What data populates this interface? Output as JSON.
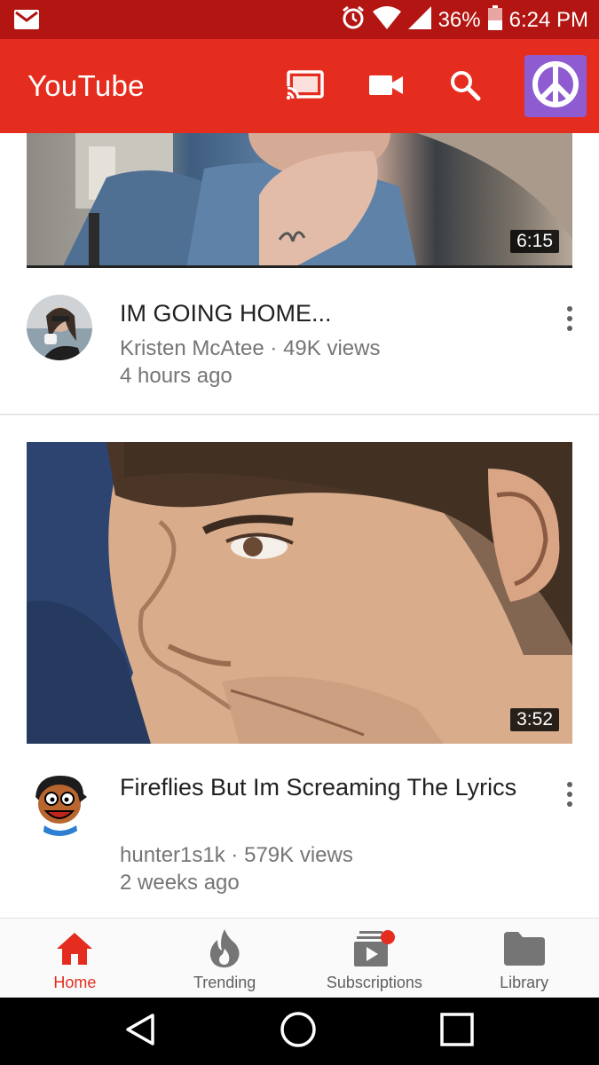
{
  "status_bar": {
    "battery": "36%",
    "time": "6:24 PM",
    "icons": [
      "gmail-icon",
      "alarm-icon",
      "wifi-icon",
      "signal-icon",
      "battery-icon"
    ]
  },
  "app_bar": {
    "title": "YouTube",
    "actions": [
      "cast-icon",
      "camera-icon",
      "search-icon",
      "account-avatar"
    ]
  },
  "feed": {
    "videos": [
      {
        "title": "IM GOING HOME...",
        "channel": "Kristen McAtee",
        "views": "49K views",
        "age": "4 hours ago",
        "duration": "6:15"
      },
      {
        "title": "Fireflies But Im Screaming The Lyrics",
        "channel": "hunter1s1k",
        "views": "579K views",
        "age": "2 weeks ago",
        "duration": "3:52"
      }
    ],
    "separator": "·"
  },
  "bottom_nav": {
    "items": [
      {
        "label": "Home",
        "icon": "home-icon",
        "active": true
      },
      {
        "label": "Trending",
        "icon": "trending-icon"
      },
      {
        "label": "Subscriptions",
        "icon": "subscriptions-icon"
      },
      {
        "label": "Library",
        "icon": "library-icon"
      }
    ]
  },
  "system_nav": [
    "back-icon",
    "home-circle-icon",
    "recents-icon"
  ],
  "colors": {
    "status_bar": "#b31512",
    "app_bar": "#e52d1f",
    "accent": "#e52d1f",
    "secondary_text": "#757575"
  }
}
